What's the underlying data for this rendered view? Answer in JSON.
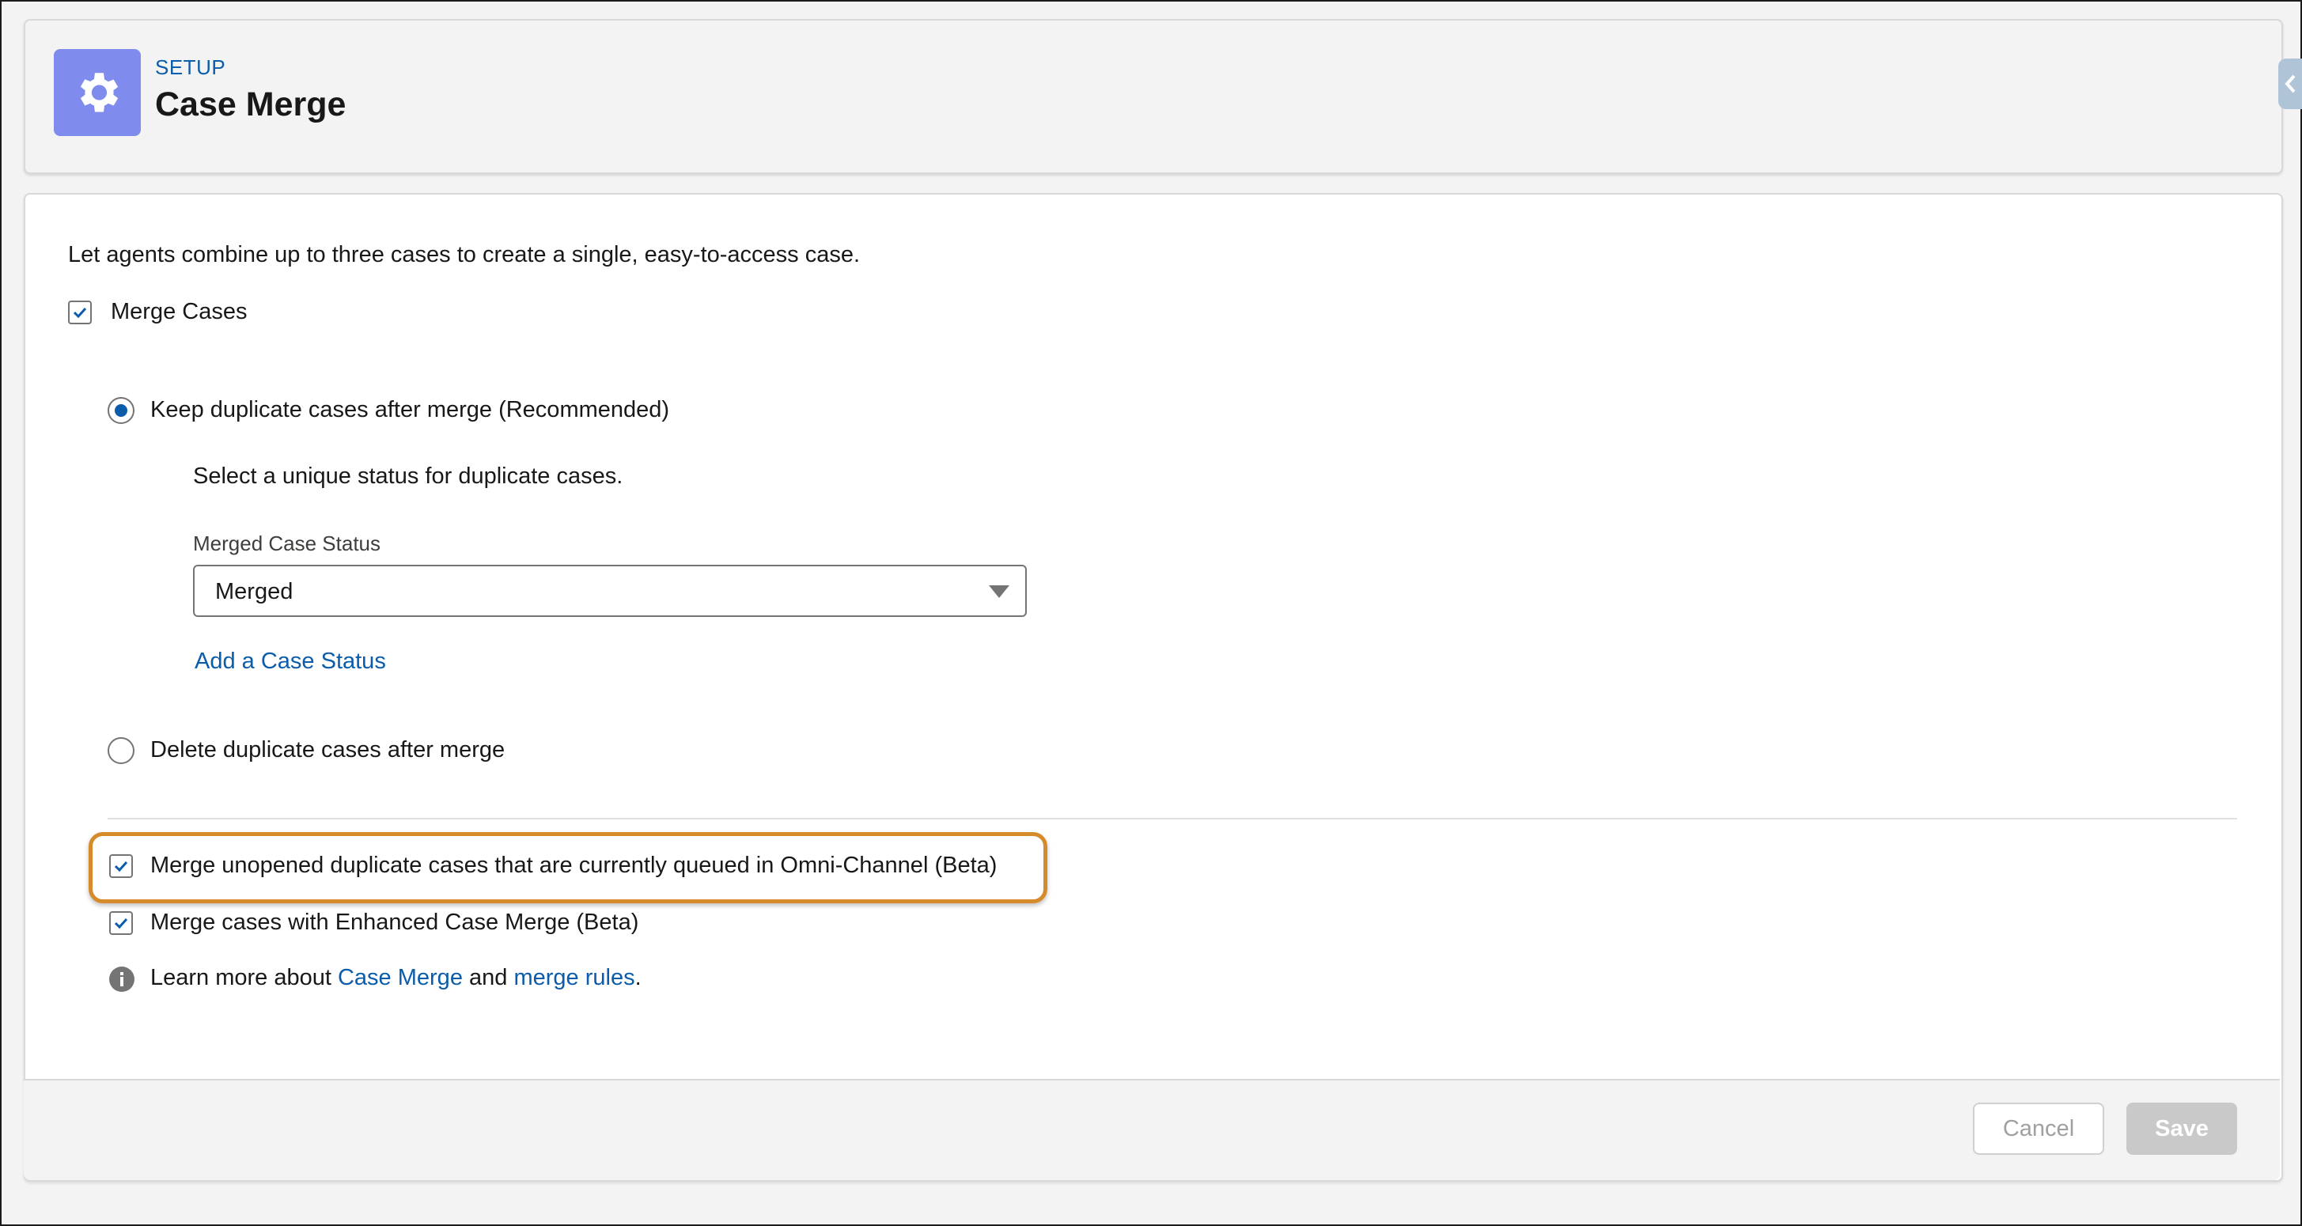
{
  "header": {
    "eyebrow": "SETUP",
    "title": "Case Merge",
    "icon": "gear-icon",
    "icon_bg_color": "#7f8ced"
  },
  "main": {
    "description": "Let agents combine up to three cases to create a single, easy-to-access case.",
    "merge_cases": {
      "label": "Merge Cases",
      "checked": true
    },
    "keep_option": {
      "label": "Keep duplicate cases after merge (Recommended)",
      "selected": true
    },
    "status_hint": "Select a unique status for duplicate cases.",
    "status_field": {
      "label": "Merged Case Status",
      "value": "Merged"
    },
    "add_status_link": "Add a Case Status",
    "delete_option": {
      "label": "Delete duplicate cases after merge",
      "selected": false
    },
    "omni_channel": {
      "label": "Merge unopened duplicate cases that are currently queued in Omni-Channel (Beta)",
      "checked": true,
      "highlight_color": "#d58a2b"
    },
    "enhanced_merge": {
      "label": "Merge cases with Enhanced Case Merge (Beta)",
      "checked": true
    },
    "learn_more": {
      "prefix": "Learn more about ",
      "link1": "Case Merge",
      "middle": " and ",
      "link2": "merge rules",
      "suffix": "."
    }
  },
  "footer": {
    "cancel_label": "Cancel",
    "save_label": "Save"
  },
  "colors": {
    "link": "#0b5cab",
    "accent": "#0b5cab"
  }
}
